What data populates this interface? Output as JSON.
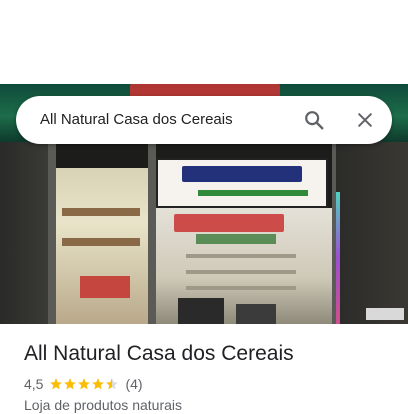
{
  "search": {
    "query": "All Natural Casa dos Cereais"
  },
  "icons": {
    "search": "search-icon",
    "close": "close-icon",
    "star": "star-icon"
  },
  "photo": {
    "storefront_sign": "CASA DOS CEREAIS",
    "storefront_subtitle": "Produtos Naturais",
    "window_text": "All Natural",
    "window_subtext": "Casa dos Cereais"
  },
  "place": {
    "name": "All Natural Casa dos Cereais",
    "rating": "4,5",
    "stars": 4.5,
    "review_count": "(4)",
    "category": "Loja de produtos naturais"
  },
  "colors": {
    "star": "#fbbc04",
    "text_primary": "#202124",
    "text_secondary": "#5f6368",
    "icon": "#5f6368"
  }
}
